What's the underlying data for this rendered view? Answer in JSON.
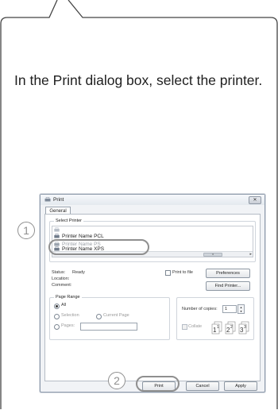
{
  "instruction": "In the Print dialog box, select the printer.",
  "dialog": {
    "title": "Print",
    "close_glyph": "✕",
    "tab": "General",
    "select_printer_label": "Select Printer",
    "printers": [
      {
        "name": "Printer Name PCL",
        "state": "selected"
      },
      {
        "name": "Printer Name PS",
        "state": "partially-hidden"
      },
      {
        "name": "Printer Name XPS",
        "state": "normal"
      }
    ],
    "scroll_thumb_glyph": "III",
    "status_label": "Status:",
    "status_value": "Ready",
    "location_label": "Location:",
    "comment_label": "Comment:",
    "print_to_file_label": "Print to file",
    "preferences_button": "Preferences",
    "find_printer_button": "Find Printer...",
    "page_range_label": "Page Range",
    "range_all": "All",
    "range_selection": "Selection",
    "range_current_page": "Current Page",
    "range_pages": "Pages:",
    "copies_label": "Number of copies:",
    "copies_value": "1",
    "collate_label": "Collate",
    "print_button": "Print",
    "cancel_button": "Cancel",
    "apply_button": "Apply"
  },
  "markers": {
    "step1": "1",
    "step2": "2"
  },
  "colors": {
    "marker": "#8f8f8f",
    "frame": "#444444",
    "dialog_border": "#8d9aab"
  }
}
